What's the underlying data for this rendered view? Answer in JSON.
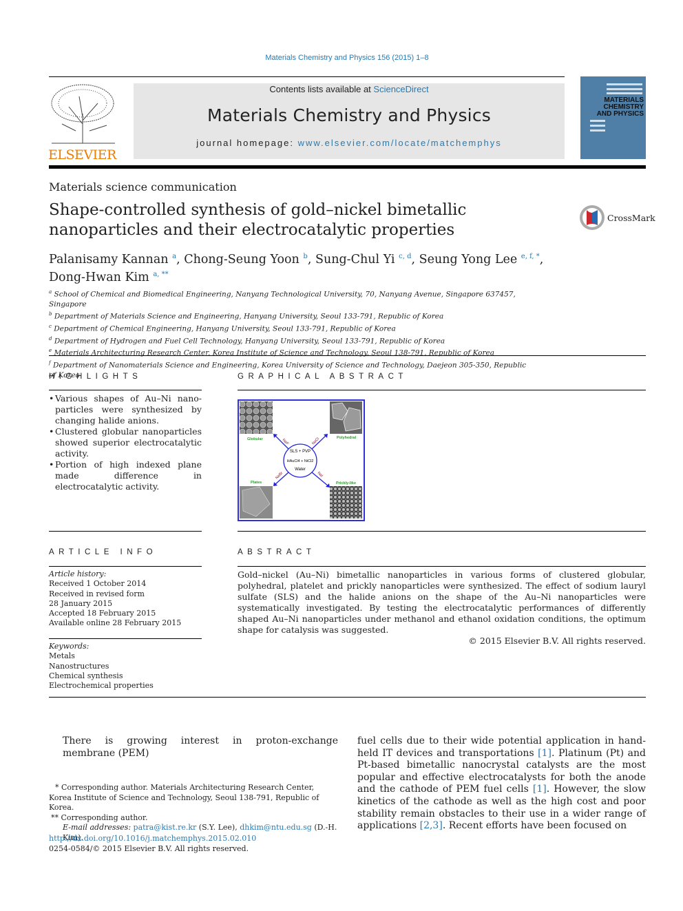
{
  "journal_citation": "Materials Chemistry and Physics 156 (2015) 1–8",
  "header": {
    "contents_prefix": "Contents lists available at ",
    "contents_link": "ScienceDirect",
    "journal_title": "Materials Chemistry and Physics",
    "homepage_prefix": "journal homepage: ",
    "homepage_link": "www.elsevier.com/locate/matchemphys",
    "publisher_logo": "ELSEVIER",
    "cover_title": "MATERIALS CHEMISTRY AND PHYSICS"
  },
  "article_type": "Materials science communication",
  "title": "Shape-controlled synthesis of gold–nickel bimetallic nanoparticles and their electrocatalytic properties",
  "crossmark": "CrossMark",
  "authors": [
    {
      "name": "Palanisamy Kannan",
      "sup": "a"
    },
    {
      "name": "Chong-Seung Yoon",
      "sup": "b"
    },
    {
      "name": "Sung-Chul Yi",
      "sup": "c, d"
    },
    {
      "name": "Seung Yong Lee",
      "sup": "e, f, *"
    },
    {
      "name": "Dong-Hwan Kim",
      "sup": "a, **"
    }
  ],
  "affiliations": [
    {
      "sup": "a",
      "text": "School of Chemical and Biomedical Engineering, Nanyang Technological University, 70, Nanyang Avenue, Singapore 637457, Singapore"
    },
    {
      "sup": "b",
      "text": "Department of Materials Science and Engineering, Hanyang University, Seoul 133-791, Republic of Korea"
    },
    {
      "sup": "c",
      "text": "Department of Chemical Engineering, Hanyang University, Seoul 133-791, Republic of Korea"
    },
    {
      "sup": "d",
      "text": "Department of Hydrogen and Fuel Cell Technology, Hanyang University, Seoul 133-791, Republic of Korea"
    },
    {
      "sup": "e",
      "text": "Materials Architecturing Research Center, Korea Institute of Science and Technology, Seoul 138-791, Republic of Korea"
    },
    {
      "sup": "f",
      "text": "Department of Nanomaterials Science and Engineering, Korea University of Science and Technology, Daejeon 305-350, Republic of Korea"
    }
  ],
  "highlights": {
    "heading": "HIGHLIGHTS",
    "items": [
      "Various shapes of Au–Ni nano-particles were synthesized by changing halide anions.",
      "Clustered globular nanoparticles showed superior electrocatalytic activity.",
      "Portion of high indexed plane made difference in electrocatalytic activity."
    ]
  },
  "graphical_abstract": {
    "heading": "GRAPHICAL ABSTRACT",
    "center": [
      "SLS + PVP",
      "HAuCl4 + NiCl2",
      "Water"
    ],
    "shapes": [
      "Globular",
      "Polyhedral",
      "Plates",
      "Prickly-like"
    ],
    "reagents": [
      "NaF",
      "NaCl",
      "NaBr",
      "NaI"
    ]
  },
  "article_info": {
    "heading": "ARTICLE INFO",
    "history_label": "Article history:",
    "history": [
      "Received 1 October 2014",
      "Received in revised form",
      "28 January 2015",
      "Accepted 18 February 2015",
      "Available online 28 February 2015"
    ],
    "keywords_label": "Keywords:",
    "keywords": [
      "Metals",
      "Nanostructures",
      "Chemical synthesis",
      "Electrochemical properties"
    ]
  },
  "abstract": {
    "heading": "ABSTRACT",
    "text": "Gold–nickel (Au–Ni) bimetallic nanoparticles in various forms of clustered globular, polyhedral, platelet and prickly nanoparticles were synthesized. The effect of sodium lauryl sulfate (SLS) and the halide anions on the shape of the Au–Ni nanoparticles were systematically investigated. By testing the electrocatalytic performances of differently shaped Au–Ni nanoparticles under methanol and ethanol oxidation conditions, the optimum shape for catalysis was suggested.",
    "copyright": "© 2015 Elsevier B.V. All rights reserved."
  },
  "body": {
    "left": "There is growing interest in proton-exchange membrane (PEM)",
    "right": [
      "fuel cells due to their wide potential application in hand-held IT devices and transportations ",
      "[1]",
      ". Platinum (Pt) and Pt-based bimetallic nanocrystal catalysts are the most popular and effective electrocatalysts for both the anode and the cathode of PEM fuel cells ",
      "[1]",
      ". However, the slow kinetics of the cathode as well as the high cost and poor stability remain obstacles to their use in a wider range of applications ",
      "[2,3]",
      ". Recent efforts have been focused on"
    ]
  },
  "footnotes": {
    "star1": "* Corresponding author. Materials Architecturing Research Center, Korea Institute of Science and Technology, Seoul 138-791, Republic of Korea.",
    "star2": "** Corresponding author.",
    "email_label": "E-mail addresses: ",
    "email1": "patra@kist.re.kr",
    "email1_who": " (S.Y. Lee), ",
    "email2": "dhkim@ntu.edu.sg",
    "email2_who": " (D.-H. Kim).",
    "doi": "http://dx.doi.org/10.1016/j.matchemphys.2015.02.010",
    "issn": "0254-0584/© 2015 Elsevier B.V. All rights reserved."
  }
}
